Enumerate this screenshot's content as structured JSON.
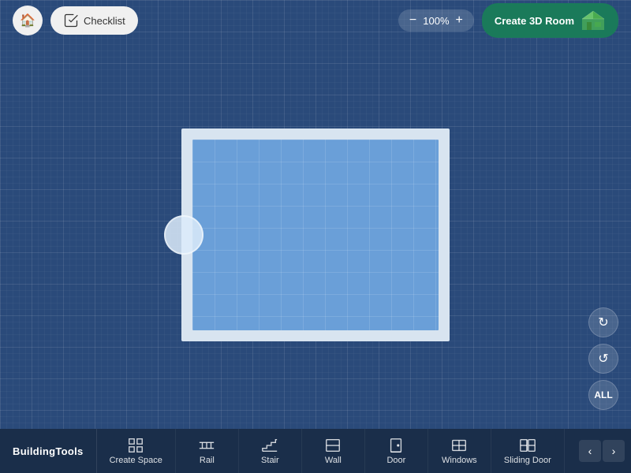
{
  "header": {
    "home_title": "Home",
    "checklist_label": "Checklist",
    "zoom_percent": "100%",
    "zoom_minus": "−",
    "zoom_plus": "+",
    "create_3d_label": "Create 3D Room"
  },
  "toolbar": {
    "brand": "BuildingTools",
    "items": [
      {
        "id": "create-space",
        "label": "Create Space",
        "icon": "grid"
      },
      {
        "id": "rail",
        "label": "Rail",
        "icon": "rail"
      },
      {
        "id": "stair",
        "label": "Stair",
        "icon": "stair"
      },
      {
        "id": "wall",
        "label": "Wall",
        "icon": "wall"
      },
      {
        "id": "door",
        "label": "Door",
        "icon": "door"
      },
      {
        "id": "windows",
        "label": "Windows",
        "icon": "windows"
      },
      {
        "id": "sliding-door",
        "label": "Sliding Door",
        "icon": "sliding-door"
      }
    ]
  },
  "right_tools": [
    {
      "id": "redo",
      "label": "Redo",
      "icon": "↻"
    },
    {
      "id": "undo",
      "label": "Undo",
      "icon": "↺"
    },
    {
      "id": "all",
      "label": "All",
      "icon": "⊞"
    }
  ],
  "canvas": {
    "zoom": "100%"
  }
}
